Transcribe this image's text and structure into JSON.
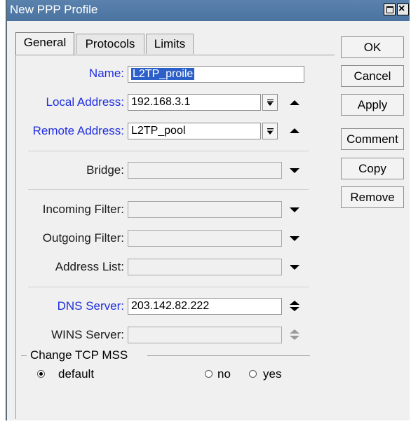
{
  "window": {
    "title": "New PPP Profile"
  },
  "tabs": [
    {
      "label": "General",
      "active": true
    },
    {
      "label": "Protocols",
      "active": false
    },
    {
      "label": "Limits",
      "active": false
    }
  ],
  "fields": {
    "name": {
      "label": "Name:",
      "value": "L2TP_proile"
    },
    "local_address": {
      "label": "Local Address:",
      "value": "192.168.3.1"
    },
    "remote_address": {
      "label": "Remote Address:",
      "value": "L2TP_pool"
    },
    "bridge": {
      "label": "Bridge:",
      "value": ""
    },
    "incoming_filter": {
      "label": "Incoming Filter:",
      "value": ""
    },
    "outgoing_filter": {
      "label": "Outgoing Filter:",
      "value": ""
    },
    "address_list": {
      "label": "Address List:",
      "value": ""
    },
    "dns_server": {
      "label": "DNS Server:",
      "value": "203.142.82.222"
    },
    "wins_server": {
      "label": "WINS Server:",
      "value": ""
    }
  },
  "change_tcp_mss": {
    "title": "Change TCP MSS",
    "options": [
      "default",
      "no",
      "yes"
    ],
    "selected": "default"
  },
  "buttons": {
    "ok": "OK",
    "cancel": "Cancel",
    "apply": "Apply",
    "comment": "Comment",
    "copy": "Copy",
    "remove": "Remove"
  },
  "colors": {
    "titlebar": "#4b73a0",
    "label_blue": "#1f2ee0",
    "selection": "#2d5fc9"
  }
}
